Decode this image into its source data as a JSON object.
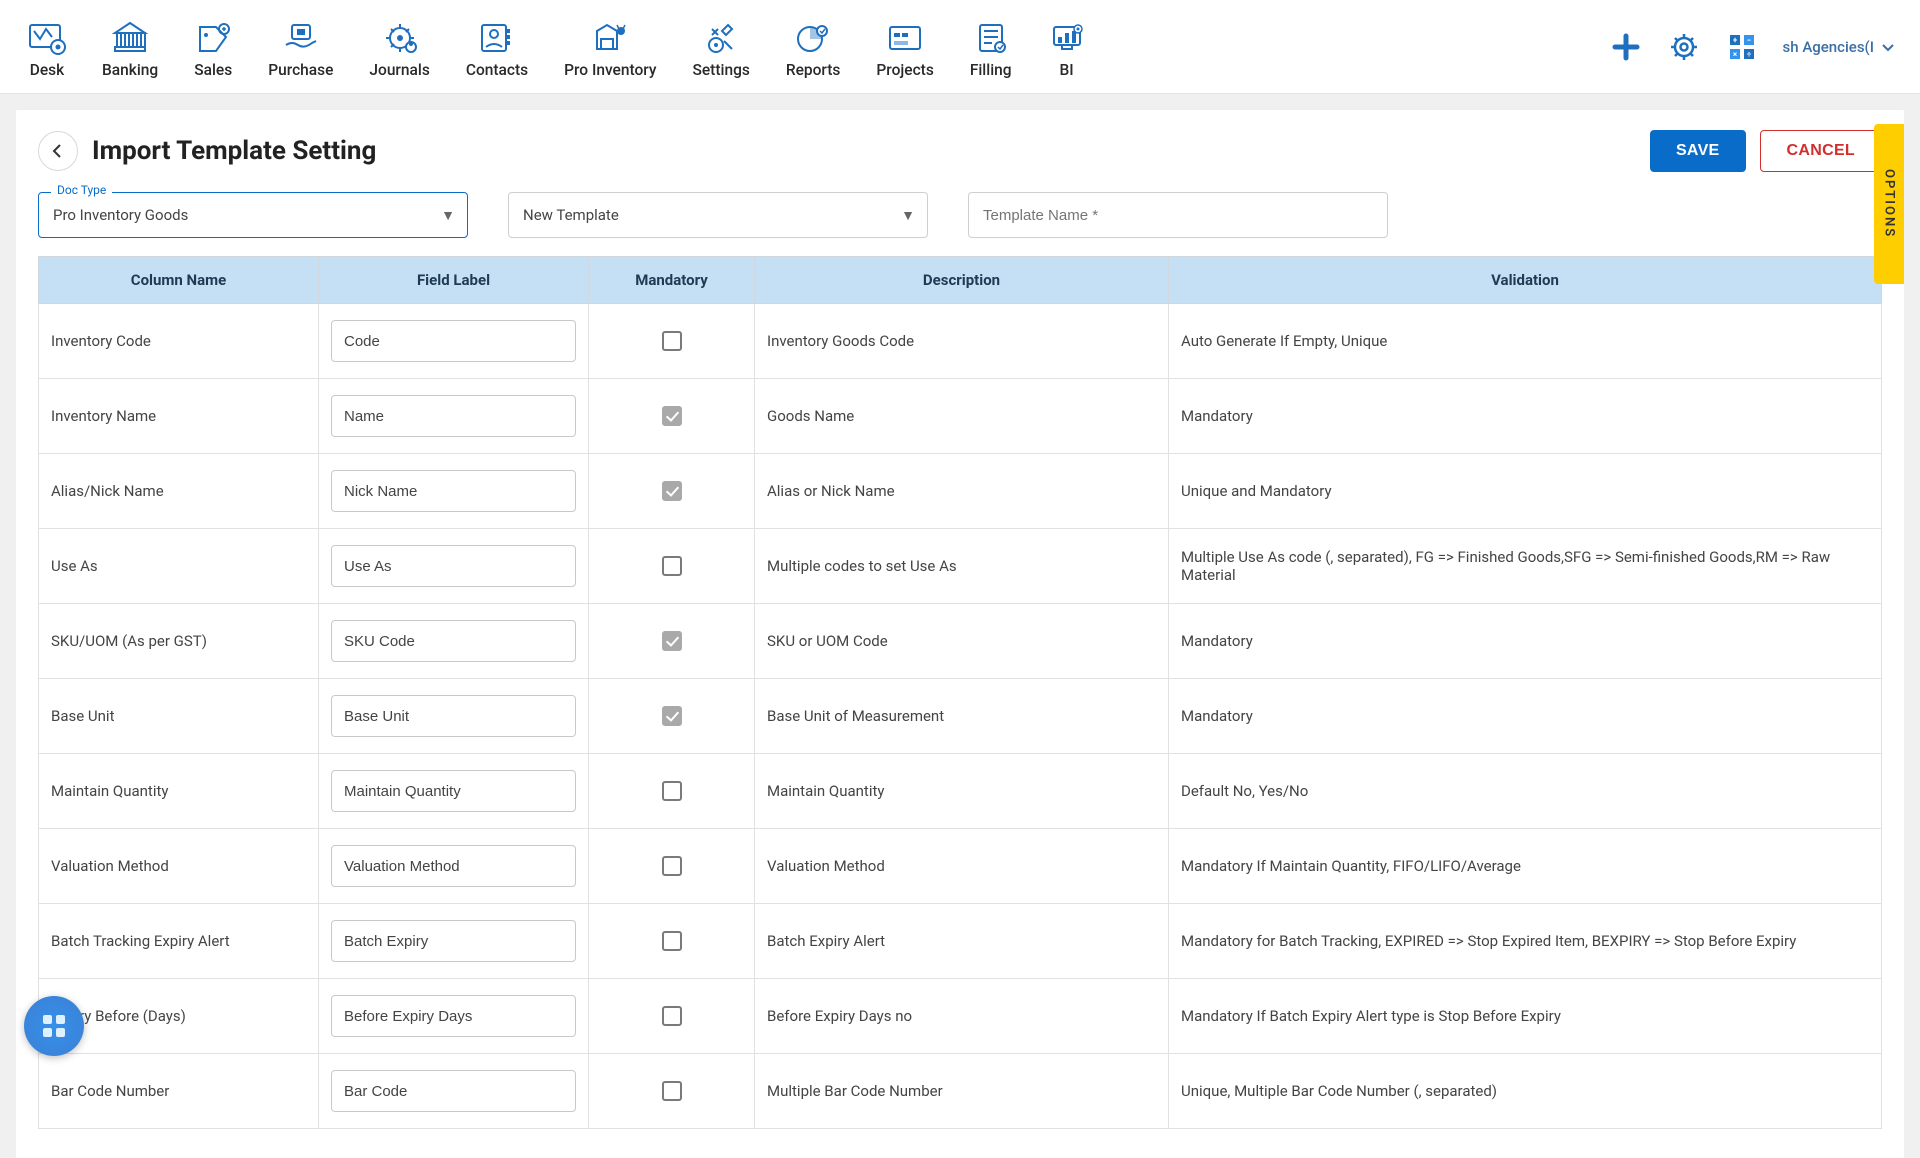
{
  "nav": {
    "items": [
      {
        "label": "Desk"
      },
      {
        "label": "Banking"
      },
      {
        "label": "Sales"
      },
      {
        "label": "Purchase"
      },
      {
        "label": "Journals"
      },
      {
        "label": "Contacts"
      },
      {
        "label": "Pro Inventory"
      },
      {
        "label": "Settings"
      },
      {
        "label": "Reports"
      },
      {
        "label": "Projects"
      },
      {
        "label": "Filling"
      },
      {
        "label": "BI"
      }
    ],
    "tenant": "sh Agencies(I"
  },
  "page": {
    "title": "Import Template Setting",
    "save_label": "SAVE",
    "cancel_label": "CANCEL",
    "options_label": "OPTIONS"
  },
  "form": {
    "doc_type_label": "Doc Type",
    "doc_type_value": "Pro Inventory Goods",
    "template_select_value": "New Template",
    "template_name_placeholder": "Template Name *"
  },
  "table": {
    "headers": {
      "column_name": "Column Name",
      "field_label": "Field Label",
      "mandatory": "Mandatory",
      "description": "Description",
      "validation": "Validation"
    },
    "rows": [
      {
        "name": "Inventory Code",
        "label": "Code",
        "mandatory": false,
        "desc": "Inventory Goods Code",
        "validation": "Auto Generate If Empty, Unique"
      },
      {
        "name": "Inventory Name",
        "label": "Name",
        "mandatory": true,
        "desc": "Goods Name",
        "validation": "Mandatory"
      },
      {
        "name": "Alias/Nick Name",
        "label": "Nick Name",
        "mandatory": true,
        "desc": "Alias or Nick Name",
        "validation": "Unique and Mandatory"
      },
      {
        "name": "Use As",
        "label": "Use As",
        "mandatory": false,
        "desc": "Multiple codes to set Use As",
        "validation": "Multiple Use As code (, separated), FG => Finished Goods,SFG => Semi-finished Goods,RM => Raw Material"
      },
      {
        "name": "SKU/UOM (As per GST)",
        "label": "SKU Code",
        "mandatory": true,
        "desc": "SKU or UOM Code",
        "validation": "Mandatory"
      },
      {
        "name": "Base Unit",
        "label": "Base Unit",
        "mandatory": true,
        "desc": "Base Unit of Measurement",
        "validation": "Mandatory"
      },
      {
        "name": "Maintain Quantity",
        "label": "Maintain Quantity",
        "mandatory": false,
        "desc": "Maintain Quantity",
        "validation": "Default No, Yes/No"
      },
      {
        "name": "Valuation Method",
        "label": "Valuation Method",
        "mandatory": false,
        "desc": "Valuation Method",
        "validation": "Mandatory If Maintain Quantity, FIFO/LIFO/Average"
      },
      {
        "name": "Batch Tracking Expiry Alert",
        "label": "Batch Expiry",
        "mandatory": false,
        "desc": "Batch Expiry Alert",
        "validation": "Mandatory for Batch Tracking, EXPIRED => Stop Expired Item, BEXPIRY => Stop Before Expiry"
      },
      {
        "name": "Expiry Before (Days)",
        "label": "Before Expiry Days",
        "mandatory": false,
        "desc": "Before Expiry Days no",
        "validation": "Mandatory If Batch Expiry Alert type is Stop Before Expiry"
      },
      {
        "name": "Bar Code Number",
        "label": "Bar Code",
        "mandatory": false,
        "desc": "Multiple Bar Code Number",
        "validation": "Unique, Multiple Bar Code Number (, separated)"
      }
    ]
  }
}
